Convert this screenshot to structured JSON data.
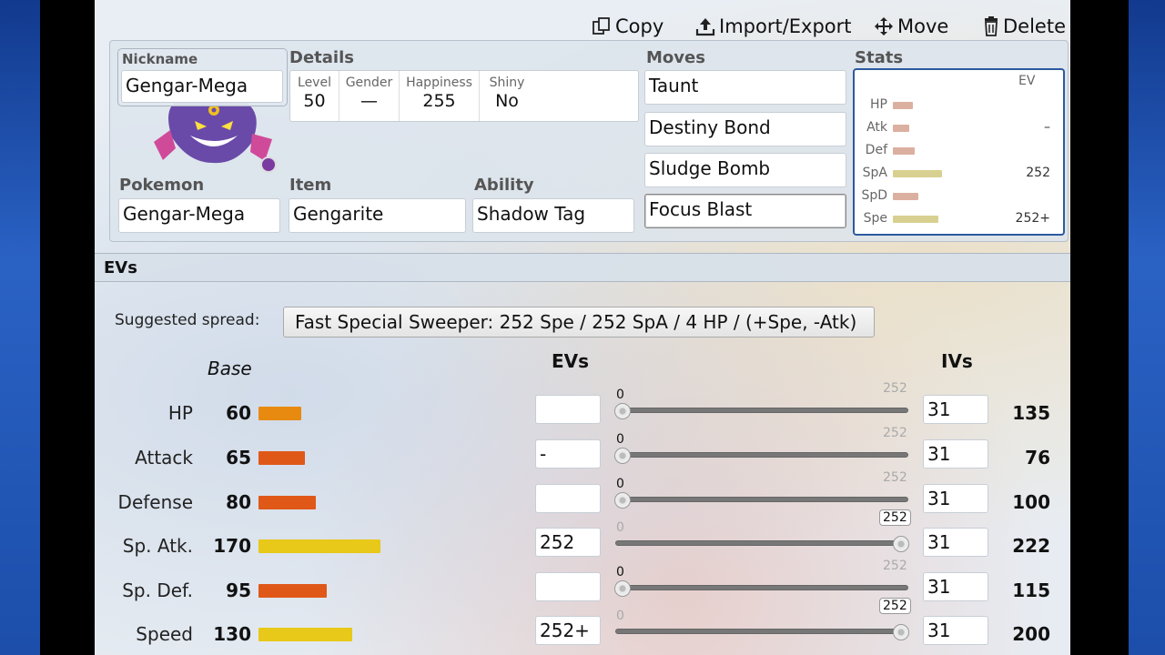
{
  "toolbar": {
    "copy": "Copy",
    "import_export": "Import/Export",
    "move": "Move",
    "delete": "Delete"
  },
  "set": {
    "nickname_label": "Nickname",
    "nickname_value": "Gengar-Mega",
    "details_label": "Details",
    "details": [
      {
        "label": "Level",
        "value": "50"
      },
      {
        "label": "Gender",
        "value": "—"
      },
      {
        "label": "Happiness",
        "value": "255"
      },
      {
        "label": "Shiny",
        "value": "No"
      }
    ],
    "pokemon_label": "Pokemon",
    "pokemon_value": "Gengar-Mega",
    "item_label": "Item",
    "item_value": "Gengarite",
    "ability_label": "Ability",
    "ability_value": "Shadow Tag",
    "moves_label": "Moves",
    "moves": [
      "Taunt",
      "Destiny Bond",
      "Sludge Bomb",
      "Focus Blast"
    ],
    "stats_label": "Stats",
    "mini_stats": {
      "ev_header": "EV",
      "rows": [
        {
          "label": "HP",
          "ev": ""
        },
        {
          "label": "Atk",
          "ev": "–"
        },
        {
          "label": "Def",
          "ev": ""
        },
        {
          "label": "SpA",
          "ev": "252"
        },
        {
          "label": "SpD",
          "ev": ""
        },
        {
          "label": "Spe",
          "ev": "252+"
        }
      ]
    }
  },
  "evs": {
    "header": "EVs",
    "suggested_label": "Suggested spread:",
    "suggested_value": "Fast Special Sweeper: 252 Spe / 252 SpA / 4 HP / (+Spe, -Atk)",
    "base_header": "Base",
    "evs_header": "EVs",
    "ivs_header": "IVs",
    "slider_min": "0",
    "slider_max": "252",
    "stats": [
      {
        "name": "HP",
        "base": "60",
        "ev": "",
        "iv": "31",
        "total": "135",
        "ev_value": 0
      },
      {
        "name": "Attack",
        "base": "65",
        "ev": "-",
        "iv": "31",
        "total": "76",
        "ev_value": 0
      },
      {
        "name": "Defense",
        "base": "80",
        "ev": "",
        "iv": "31",
        "total": "100",
        "ev_value": 0
      },
      {
        "name": "Sp. Atk.",
        "base": "170",
        "ev": "252",
        "iv": "31",
        "total": "222",
        "ev_value": 252
      },
      {
        "name": "Sp. Def.",
        "base": "95",
        "ev": "",
        "iv": "31",
        "total": "115",
        "ev_value": 0
      },
      {
        "name": "Speed",
        "base": "130",
        "ev": "252+",
        "iv": "31",
        "total": "200",
        "ev_value": 252
      }
    ]
  },
  "colors": {
    "accent_border": "#2c5aa0",
    "bar_red": "#e05818",
    "bar_orange": "#e88a10",
    "bar_yellow": "#e8c818"
  }
}
